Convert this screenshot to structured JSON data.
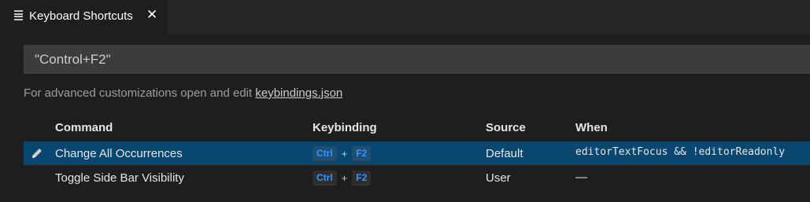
{
  "tab": {
    "title": "Keyboard Shortcuts",
    "icon": "list-icon",
    "close_glyph": "✕"
  },
  "search": {
    "value": "\"Control+F2\""
  },
  "hint": {
    "text": "For advanced customizations open and edit ",
    "link": "keybindings.json"
  },
  "table": {
    "headers": {
      "command": "Command",
      "keybinding": "Keybinding",
      "source": "Source",
      "when": "When"
    },
    "rows": [
      {
        "command": "Change All Occurrences",
        "keys": [
          "Ctrl",
          "F2"
        ],
        "plus": "+",
        "source": "Default",
        "when": "editorTextFocus && !editorReadonly",
        "selected": true
      },
      {
        "command": "Toggle Side Bar Visibility",
        "keys": [
          "Ctrl",
          "F2"
        ],
        "plus": "+",
        "source": "User",
        "when": "—",
        "selected": false
      }
    ]
  },
  "colors": {
    "selection": "#094771",
    "keycap_text": "#3794ff"
  }
}
